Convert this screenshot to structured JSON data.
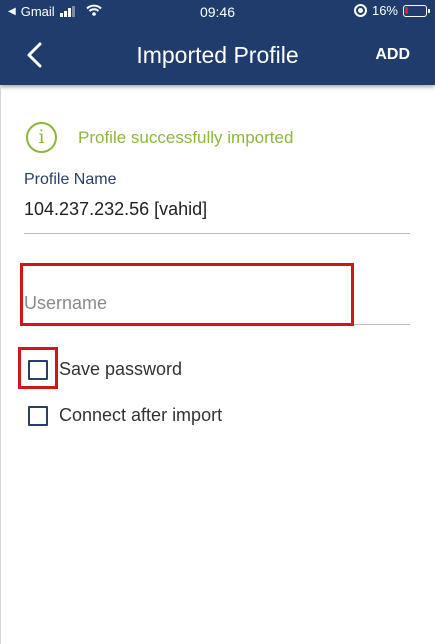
{
  "status_bar": {
    "back_indicator": "◀",
    "carrier": "Gmail",
    "time": "09:46",
    "battery": "16%",
    "battery_level": 0.16
  },
  "header": {
    "title": "Imported Profile",
    "action_label": "ADD",
    "background_color": "#1f3c6d"
  },
  "alert": {
    "icon": "info-circle-icon",
    "icon_glyph": "i",
    "message": "Profile successfully imported",
    "color": "#8bb83a"
  },
  "profile": {
    "label": "Profile Name",
    "value": "104.237.232.56 [vahid]"
  },
  "username": {
    "value": "",
    "placeholder": "Username"
  },
  "options": {
    "save_password": {
      "label": "Save password",
      "checked": false
    },
    "connect_after_import": {
      "label": "Connect after import",
      "checked": false
    }
  },
  "highlight_color": "#d0161c"
}
